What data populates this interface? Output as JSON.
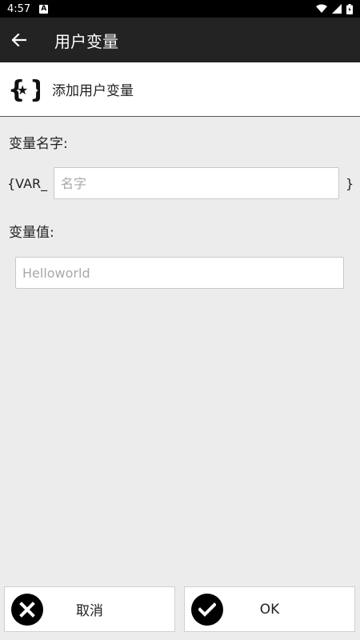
{
  "status_bar": {
    "time": "4:57",
    "notification_icon": "A",
    "icons": [
      "wifi-icon",
      "signal-icon",
      "battery-icon"
    ]
  },
  "app_bar": {
    "title": "用户变量",
    "back_icon": "arrow-left-icon"
  },
  "section": {
    "icon": "curly-braces-star-icon",
    "title": "添加用户变量"
  },
  "form": {
    "name_label": "变量名字:",
    "name_prefix": "{VAR_",
    "name_suffix": "}",
    "name_placeholder": "名字",
    "name_value": "",
    "value_label": "变量值:",
    "value_placeholder": "Helloworld",
    "value_value": ""
  },
  "buttons": {
    "cancel_label": "取消",
    "cancel_icon": "x-circle-icon",
    "ok_label": "OK",
    "ok_icon": "check-circle-icon"
  },
  "colors": {
    "app_bar": "#232323",
    "status_bar": "#000000",
    "background": "#ececec"
  }
}
